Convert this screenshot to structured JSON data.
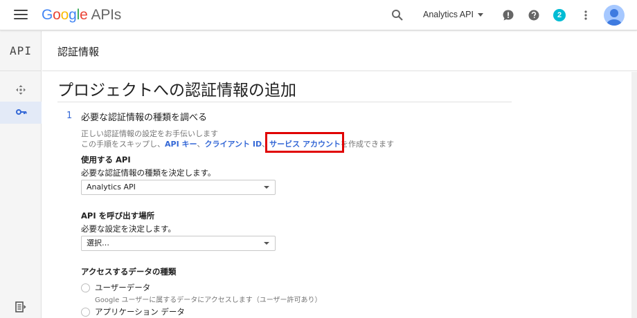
{
  "header": {
    "logo_brand": "Google",
    "logo_product": "APIs",
    "project_name": "Analytics API",
    "notification_count": "2"
  },
  "sidebar": {
    "api_label": "API"
  },
  "subheader": {
    "title": "認証情報"
  },
  "main": {
    "page_title": "プロジェクトへの認証情報の追加",
    "step": {
      "number": "1",
      "title": "必要な認証情報の種類を調べる",
      "hint_line1": "正しい認証情報の設定をお手伝いします",
      "hint_prefix": "この手順をスキップし、",
      "link_api_key": "API キー",
      "sep1": "、",
      "link_client_id": "クライアント ID",
      "sep2": "、",
      "link_service_account": "サービス アカウント",
      "hint_suffix": "を作成できます"
    },
    "api_section": {
      "label": "使用する API",
      "description": "必要な認証情報の種類を決定します。",
      "selected": "Analytics API"
    },
    "call_section": {
      "label": "API を呼び出す場所",
      "description": "必要な設定を決定します。",
      "selected": "選択…"
    },
    "data_section": {
      "label": "アクセスするデータの種類",
      "options": [
        {
          "label": "ユーザーデータ",
          "description": "Google ユーザーに属するデータにアクセスします（ユーザー許可あり）"
        },
        {
          "label": "アプリケーション データ"
        }
      ]
    }
  },
  "colors": {
    "link": "#3367d6",
    "highlight": "#e00000",
    "badge": "#00bcd4"
  }
}
